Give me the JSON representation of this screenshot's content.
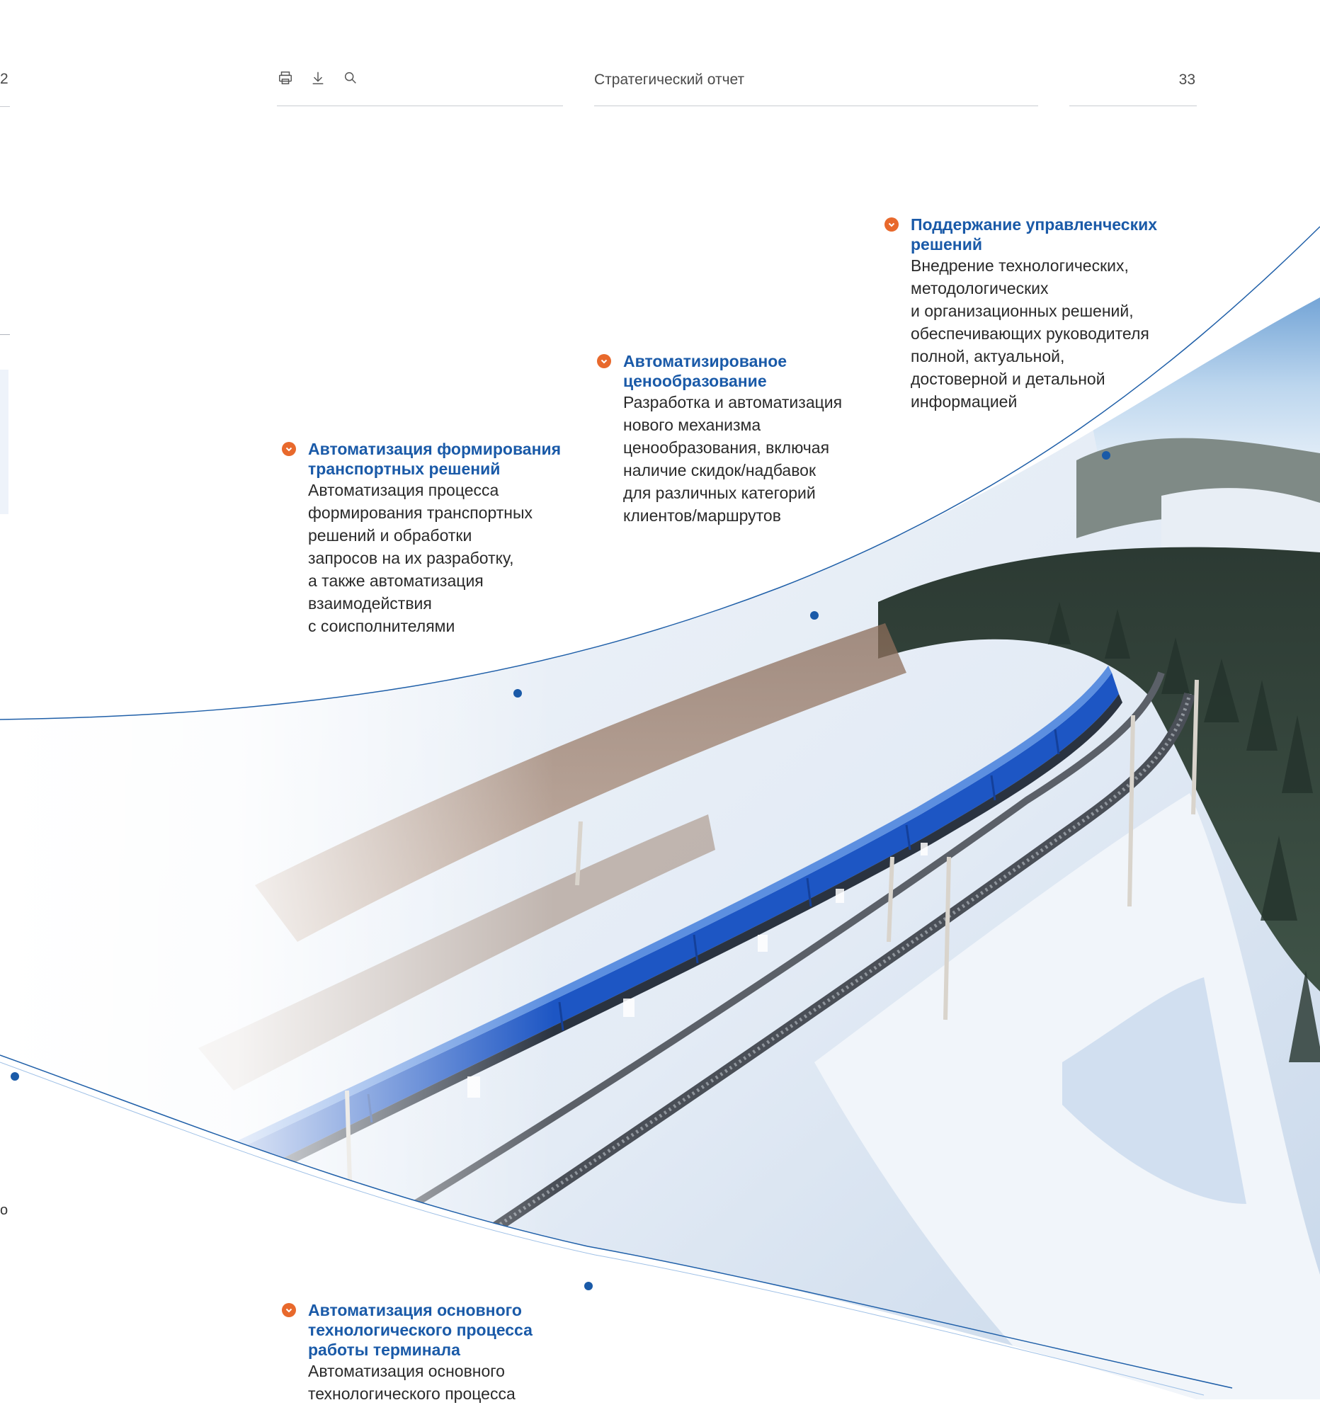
{
  "header": {
    "left_page_number": "2",
    "title": "Стратегический отчет",
    "page_number": "33",
    "tools": [
      {
        "name": "print-icon"
      },
      {
        "name": "download-icon"
      },
      {
        "name": "search-icon"
      }
    ]
  },
  "left_fragment": {
    "char": "о"
  },
  "items": [
    {
      "title": "Автоматизация формирования транспортных решений",
      "text": "Автоматизация процесса\nформирования транспортных\nрешений и обработки\nзапросов на их разработку,\nа также автоматизация\nвзаимодействия\nс соисполнителями"
    },
    {
      "title": "Автоматизированое ценообразование",
      "text": "Разработка и автоматизация\nнового механизма\nценообразования, включая\nналичие скидок/надбавок\nдля различных категорий\nклиентов/маршрутов"
    },
    {
      "title": "Поддержание управленческих решений",
      "text": "Внедрение технологических,\nметодологических\nи организационных решений,\nобеспечивающих руководителя\nполной, актуальной,\nдостоверной и детальной\nинформацией"
    },
    {
      "title": "Автоматизация основного технологического процесса работы терминала",
      "text": "Автоматизация основного\nтехнологического процесса"
    }
  ],
  "colors": {
    "accent_blue": "#1a5aa8",
    "bullet_orange": "#e8692c",
    "line_blue": "#1f5fa8",
    "container_blue": "#1d56c4"
  }
}
